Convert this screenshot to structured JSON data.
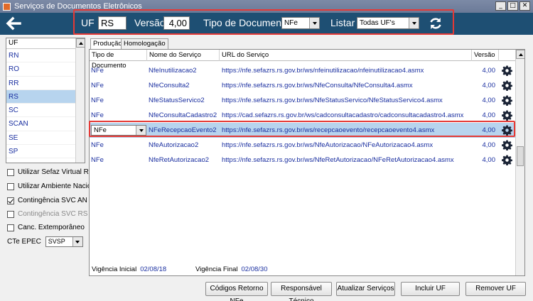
{
  "window": {
    "title": "Serviços de Documentos Eletrônicos"
  },
  "header": {
    "uf_label": "UF",
    "uf_value": "RS",
    "versao_label": "Versão",
    "versao_value": "4,00",
    "tipo_label": "Tipo de Documento",
    "tipo_value": "NFe",
    "listar_label": "Listar",
    "listar_value": "Todas UF's"
  },
  "uf_list": {
    "header": "UF",
    "items": [
      "RN",
      "RO",
      "RR",
      "RS",
      "SC",
      "SCAN",
      "SE",
      "SP"
    ],
    "selected": "RS"
  },
  "options": {
    "sefaz_virtual_rs": "Utilizar Sefaz Virtual RS",
    "ambiente_nacional": "Utilizar Ambiente Nacional",
    "svc_an": "Contingência SVC AN",
    "svc_rs": "Contingência SVC RS",
    "canc_extemporaneo": "Canc. Extemporâneo",
    "cte_epec_label": "CTe EPEC",
    "cte_epec_value": "SVSP"
  },
  "tabs": [
    "Produção",
    "Homologação"
  ],
  "grid": {
    "columns": [
      "Tipo de Documento",
      "Nome do Serviço",
      "URL do Serviço",
      "Versão"
    ],
    "rows": [
      {
        "tipo": "NFe",
        "nome": "NfeInutilizacao2",
        "url": "https://nfe.sefazrs.rs.gov.br/ws/nfeinutilizacao/nfeinutilizacao4.asmx",
        "versao": "4,00"
      },
      {
        "tipo": "NFe",
        "nome": "NfeConsulta2",
        "url": "https://nfe.sefazrs.rs.gov.br/ws/NfeConsulta/NfeConsulta4.asmx",
        "versao": "4,00"
      },
      {
        "tipo": "NFe",
        "nome": "NfeStatusServico2",
        "url": "https://nfe.sefazrs.rs.gov.br/ws/NfeStatusServico/NfeStatusServico4.asmx",
        "versao": "4,00"
      },
      {
        "tipo": "NFe",
        "nome": "NfeConsultaCadastro2",
        "url": "https://cad.sefazrs.rs.gov.br/ws/cadconsultacadastro/cadconsultacadastro4.asmx",
        "versao": "4,00"
      },
      {
        "tipo": "NFe",
        "nome": "NFeRecepcaoEvento2",
        "url": "https://nfe.sefazrs.rs.gov.br/ws/recepcaoevento/recepcaoevento4.asmx",
        "versao": "4,00"
      },
      {
        "tipo": "NFe",
        "nome": "NfeAutorizacao2",
        "url": "https://nfe.sefazrs.rs.gov.br/ws/NfeAutorizacao/NFeAutorizacao4.asmx",
        "versao": "4,00"
      },
      {
        "tipo": "NFe",
        "nome": "NfeRetAutorizacao2",
        "url": "https://nfe.sefazrs.rs.gov.br/ws/NfeRetAutorizacao/NFeRetAutorizacao4.asmx",
        "versao": "4,00"
      }
    ]
  },
  "vigencia": {
    "inicial_label": "Vigência Inicial",
    "inicial_value": "02/08/18",
    "final_label": "Vigência Final",
    "final_value": "02/08/30"
  },
  "buttons": {
    "codigos": "Códigos Retorno NFe",
    "responsavel": "Responsável Técnico",
    "atualizar": "Atualizar Serviços",
    "incluir": "Incluir UF",
    "remover": "Remover UF"
  },
  "colors": {
    "header_bg": "#1e4f73",
    "highlight": "#e53935",
    "selection": "#b7d4ee",
    "link_text": "#1a2fa0"
  }
}
